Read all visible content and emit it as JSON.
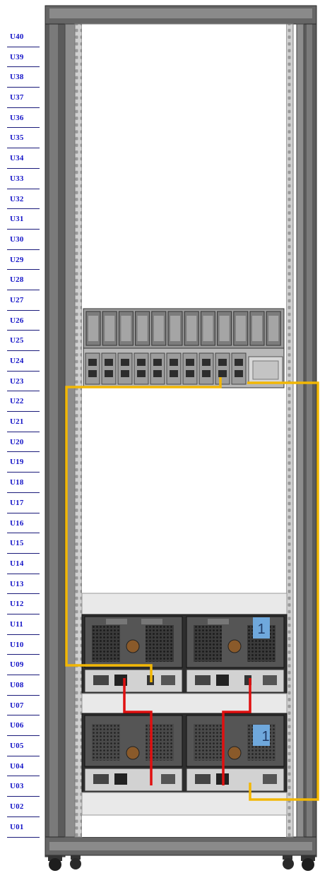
{
  "rack": {
    "units": [
      "U40",
      "U39",
      "U38",
      "U37",
      "U36",
      "U35",
      "U34",
      "U33",
      "U32",
      "U31",
      "U30",
      "U29",
      "U28",
      "U27",
      "U26",
      "U25",
      "U24",
      "U23",
      "U22",
      "U21",
      "U20",
      "U19",
      "U18",
      "U17",
      "U16",
      "U15",
      "U14",
      "U13",
      "U12",
      "U11",
      "U10",
      "U09",
      "U08",
      "U07",
      "U06",
      "U05",
      "U04",
      "U03",
      "U02",
      "U01"
    ],
    "enclosures": [
      {
        "badge": "1"
      },
      {
        "badge": "1"
      }
    ],
    "colors": {
      "frame": "#5a5a5a",
      "rail": "#cfcfcf",
      "cable_yellow": "#f2b705",
      "cable_red": "#e01010",
      "badge": "#6fa8dc",
      "label": "#1515c8"
    }
  }
}
